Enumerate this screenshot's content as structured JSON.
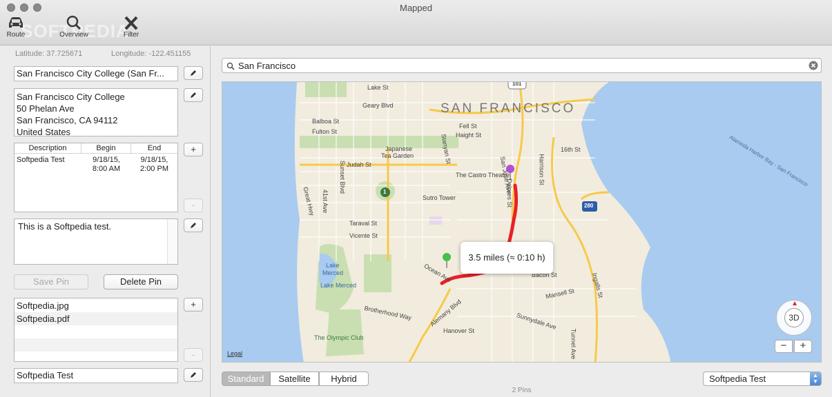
{
  "window": {
    "title": "Mapped",
    "watermark": "SOFTPEDIA"
  },
  "toolbar": {
    "route_label": "Route",
    "overview_label": "Overview",
    "filter_label": "Filter"
  },
  "sidebar": {
    "latitude": "Latitude: 37.725671",
    "longitude": "Longitude: -122.451155",
    "pin_title": "San Francisco City College (San Fr...",
    "address": {
      "line1": "San Francisco City College",
      "line2": "50 Phelan Ave",
      "line3": "San Francisco, CA  94112",
      "line4": "United States"
    },
    "events": {
      "headers": [
        "Description",
        "Begin",
        "End"
      ],
      "rows": [
        {
          "description": "Softpedia Test",
          "begin_date": "9/18/15,",
          "begin_time": "8:00 AM",
          "end_date": "9/18/15,",
          "end_time": "2:00 PM"
        }
      ]
    },
    "notes": "This is a Softpedia test.",
    "save_pin_label": "Save Pin",
    "delete_pin_label": "Delete Pin",
    "files": [
      "Softpedia.jpg",
      "Softpedia.pdf"
    ],
    "group_name": "Softpedia Test",
    "add_symbol": "+",
    "remove_symbol": "-",
    "edit_icon": "pencil-icon"
  },
  "main": {
    "search_value": "San Francisco",
    "map": {
      "city_label": "SAN FRANCISCO",
      "route_callout": "3.5 miles (≈ 0:10 h)",
      "legal_label": "Legal",
      "compass_label": "3D",
      "zoom_out": "−",
      "zoom_in": "+",
      "labels": {
        "lake_st": "Lake St",
        "geary": "Geary Blvd",
        "balboa": "Balboa St",
        "fulton": "Fulton St",
        "fell": "Fell St",
        "haight": "Haight St",
        "japanese_tea": "Japanese",
        "tea_garden": "Tea Garden",
        "judah": "Judah St",
        "castro": "The Castro Theatre",
        "sutro": "Sutro Tower",
        "taraval": "Taraval St",
        "vicente": "Vicente St",
        "great_hwy": "Great Hwy",
        "sunset": "Sunset Blvd",
        "ave41": "41st Ave",
        "lake_merced_1": "Lake",
        "lake_merced_2": "Merced",
        "lake_merced_3": "Lake Merced",
        "olympic": "The Olympic Club",
        "brotherhood": "Brotherhood Way",
        "alemany": "Alemany Blvd",
        "ocean": "Ocean Ave",
        "hanover": "Hanover St",
        "sunnydale": "Sunnydale Ave",
        "mansell": "Mansell St",
        "bacon": "Bacon St",
        "ingalls": "Ingalls St",
        "tunnel": "Tunnel Ave",
        "st16": "16th St",
        "harrison": "Harrison St",
        "alameda": "Alameda Harbor Bay - San Francisco",
        "san_jose": "San Jose Ave",
        "dolores": "Dolores St",
        "stanyan": "Stanyan St",
        "hwy101": "101",
        "hwy280": "280",
        "hwy1": "1"
      }
    },
    "map_types": [
      "Standard",
      "Satellite",
      "Hybrid"
    ],
    "active_map_type": "Standard",
    "group_select": "Softpedia Test",
    "pin_count": "2 Pins"
  },
  "colors": {
    "route": "#e8202a",
    "water": "#a9cbf0",
    "park": "#c9dfb2",
    "highway": "#f7c948"
  }
}
